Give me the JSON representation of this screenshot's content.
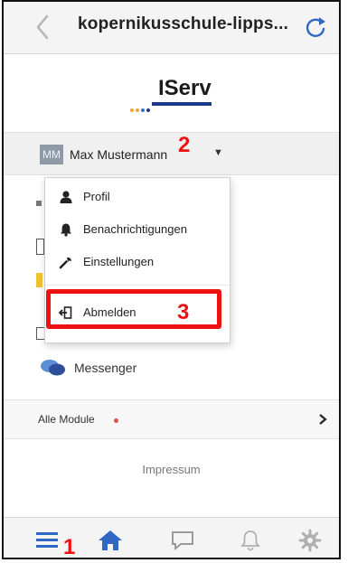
{
  "browser": {
    "url_title": "kopernikusschule-lipps...",
    "back_icon": "chevron-left-icon",
    "reload_icon": "reload-icon"
  },
  "logo": {
    "text": "IServ",
    "colors": [
      "#f2a33a",
      "#3b6fbf",
      "#1b3b8a"
    ]
  },
  "user": {
    "initials": "MM",
    "name": "Max Mustermann",
    "avatar_color": "#8e9aa6"
  },
  "user_menu": {
    "items": [
      {
        "label": "Profil",
        "icon": "user-icon"
      },
      {
        "label": "Benachrichtigungen",
        "icon": "bell-icon"
      },
      {
        "label": "Einstellungen",
        "icon": "wrench-icon"
      },
      {
        "label": "Abmelden",
        "icon": "logout-icon"
      }
    ]
  },
  "messenger": {
    "label": "Messenger",
    "icon": "chat-bubbles-icon"
  },
  "modules": {
    "label": "Alle Module",
    "dot_color": "#e0524a"
  },
  "footer": {
    "impressum": "Impressum"
  },
  "tabbar": {
    "tabs": [
      {
        "name": "menu",
        "icon": "hamburger-icon",
        "color": "#2f67c4"
      },
      {
        "name": "home",
        "icon": "home-icon",
        "color": "#2f67c4"
      },
      {
        "name": "messages",
        "icon": "speech-bubble-icon",
        "color": "#9a9a9a"
      },
      {
        "name": "notifications",
        "icon": "bell-outline-icon",
        "color": "#9a9a9a"
      },
      {
        "name": "settings",
        "icon": "gear-icon",
        "color": "#9a9a9a"
      }
    ]
  },
  "annotations": {
    "marker_1": "1",
    "marker_2": "2",
    "marker_3": "3",
    "highlight_color": "#ee1111"
  }
}
